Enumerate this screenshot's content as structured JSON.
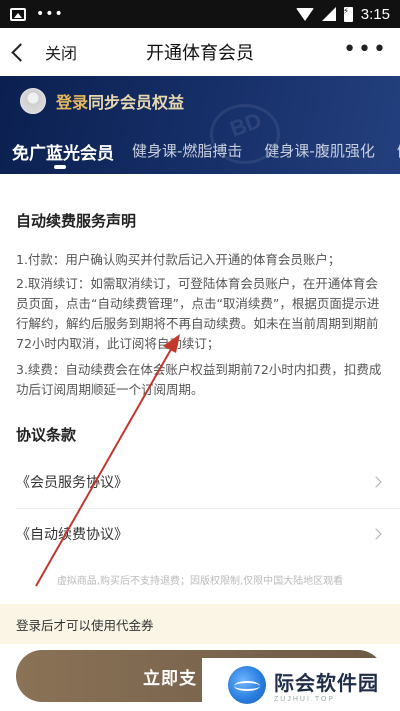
{
  "status_bar": {
    "time": "3:15"
  },
  "nav": {
    "back_label": "关闭",
    "title": "开通体育会员"
  },
  "header": {
    "login_link": "登录",
    "login_text": "同步会员权益",
    "tabs": [
      {
        "label": "免广蓝光会员",
        "active": true
      },
      {
        "label": "健身课-燃脂搏击",
        "active": false
      },
      {
        "label": "健身课-腹肌强化",
        "active": false
      },
      {
        "label": "健",
        "active": false
      }
    ],
    "deco_text": "BD"
  },
  "statement": {
    "title": "自动续费服务声明",
    "items": [
      "1.付款：用户确认购买并付款后记入开通的体育会员账户；",
      "2.取消续订：如需取消续订，可登陆体育会员账户，在开通体育会员页面，点击“自动续费管理”，点击“取消续费”，根据页面提示进行解约，解约后服务到期将不再自动续费。如未在当前周期到期前72小时内取消，此订阅将自动续订；",
      "3.续费：自动续费会在体会账户权益到期前72小时内扣费，扣费成功后订阅周期顺延一个订阅周期。"
    ]
  },
  "agreements": {
    "title": "协议条款",
    "items": [
      "《会员服务协议》",
      "《自动续费协议》"
    ]
  },
  "notice": "虚拟商品,购买后不支持退费；因版权限制,仅限中国大陆地区观看",
  "coupon_bar": "登录后才可以使用代金券",
  "pay_button": "立即支",
  "watermark": {
    "name": "际会软件园",
    "sub": "ZUJHUI.TOP"
  },
  "colors": {
    "header_bg": "#17306a",
    "gold": "#e8b75a",
    "pay_button": "#7c6650",
    "coupon_bg": "#fbf5e6",
    "arrow": "#c0392b"
  }
}
